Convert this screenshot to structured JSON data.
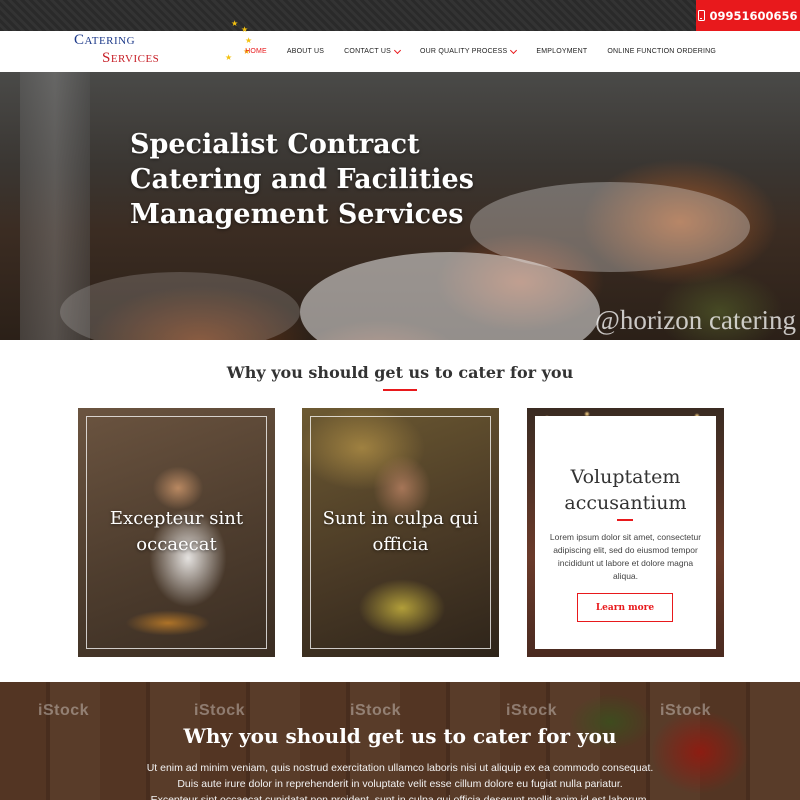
{
  "topbar": {
    "phone": "09951600656",
    "phone_icon": "mobile-phone-icon"
  },
  "logo": {
    "line1": "Catering",
    "line2": "Services",
    "colors": {
      "line1": "#1d3a8a",
      "line2": "#c71f27",
      "stars": "#f4c10f"
    }
  },
  "nav": {
    "items": [
      {
        "label": "HOME",
        "active": true
      },
      {
        "label": "ABOUT US"
      },
      {
        "label": "CONTACT US",
        "dropdown": true
      },
      {
        "label": "OUR QUALITY PROCESS",
        "dropdown": true
      },
      {
        "label": "EMPLOYMENT"
      },
      {
        "label": "ONLINE FUNCTION ORDERING"
      }
    ]
  },
  "hero": {
    "title": "Specialist Contract Catering and Facilities Management Services",
    "watermark": "@horizon catering"
  },
  "section": {
    "title": "Why you should get us to cater for you"
  },
  "cards": [
    {
      "title": "Excepteur sint occaecat"
    },
    {
      "title": "Sunt in culpa qui officia"
    },
    {
      "title": "Voluptatem accusantium",
      "text": "Lorem ipsum dolor sit amet, consectetur adipiscing elit, sed do eiusmod tempor incididunt ut labore et dolore magna aliqua.",
      "button": "Learn more"
    }
  ],
  "band": {
    "watermarks": [
      "iStock",
      "iStock",
      "iStock",
      "iStock",
      "iStock"
    ],
    "title": "Why you should get us to cater for you",
    "lines": [
      "Ut enim ad minim veniam, quis nostrud exercitation ullamco laboris nisi ut aliquip ex ea commodo consequat.",
      "Duis aute irure dolor in reprehenderit in voluptate velit esse cillum dolore eu fugiat nulla pariatur.",
      "Excepteur sint occaecat cupidatat non proident, sunt in culpa qui officia deserunt mollit anim id est laborum."
    ]
  },
  "colors": {
    "accent": "#e8191c",
    "topbar": "#2e2e2e"
  }
}
